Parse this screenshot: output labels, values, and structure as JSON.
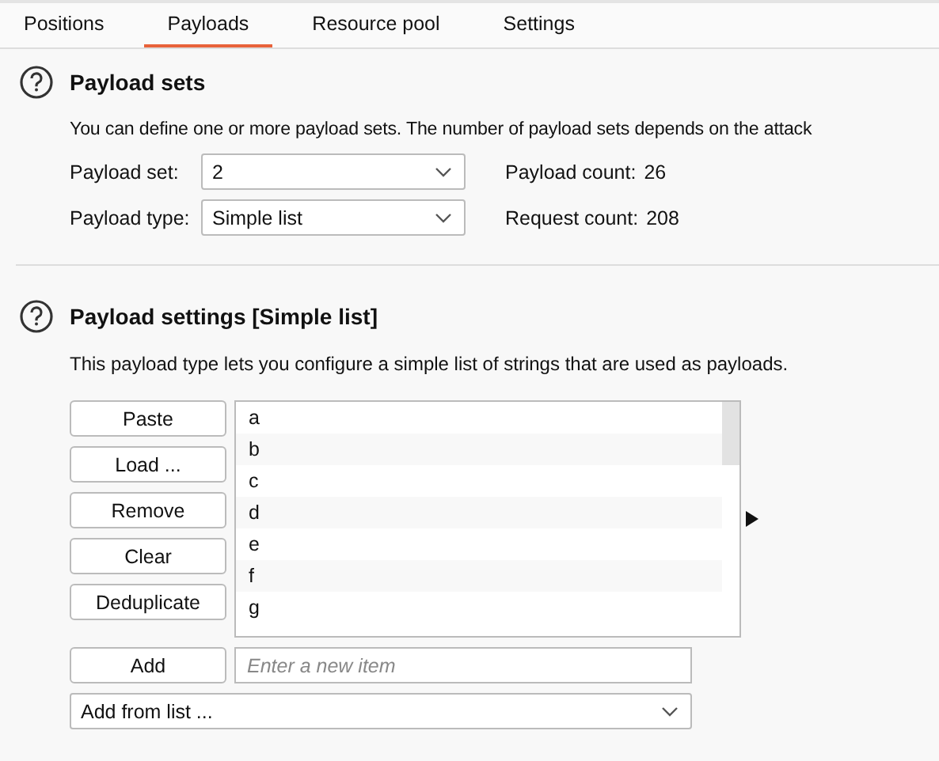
{
  "tabs": [
    {
      "label": "Positions",
      "selected": false
    },
    {
      "label": "Payloads",
      "selected": true
    },
    {
      "label": "Resource pool",
      "selected": false
    },
    {
      "label": "Settings",
      "selected": false
    }
  ],
  "payload_sets": {
    "title": "Payload sets",
    "description": "You can define one or more payload sets. The number of payload sets depends on the attack",
    "fields": [
      {
        "label": "Payload set:",
        "value": "2",
        "info_label": "Payload count:",
        "info_value": "26"
      },
      {
        "label": "Payload type:",
        "value": "Simple list",
        "info_label": "Request count:",
        "info_value": "208"
      }
    ]
  },
  "payload_settings": {
    "title": "Payload settings [Simple list]",
    "description": "This payload type lets you configure a simple list of strings that are used as payloads.",
    "buttons": [
      "Paste",
      "Load ...",
      "Remove",
      "Clear",
      "Deduplicate"
    ],
    "items": [
      "a",
      "b",
      "c",
      "d",
      "e",
      "f",
      "g"
    ],
    "add_button": "Add",
    "new_item": {
      "placeholder": "Enter a new item"
    },
    "add_from_list": "Add from list ..."
  }
}
